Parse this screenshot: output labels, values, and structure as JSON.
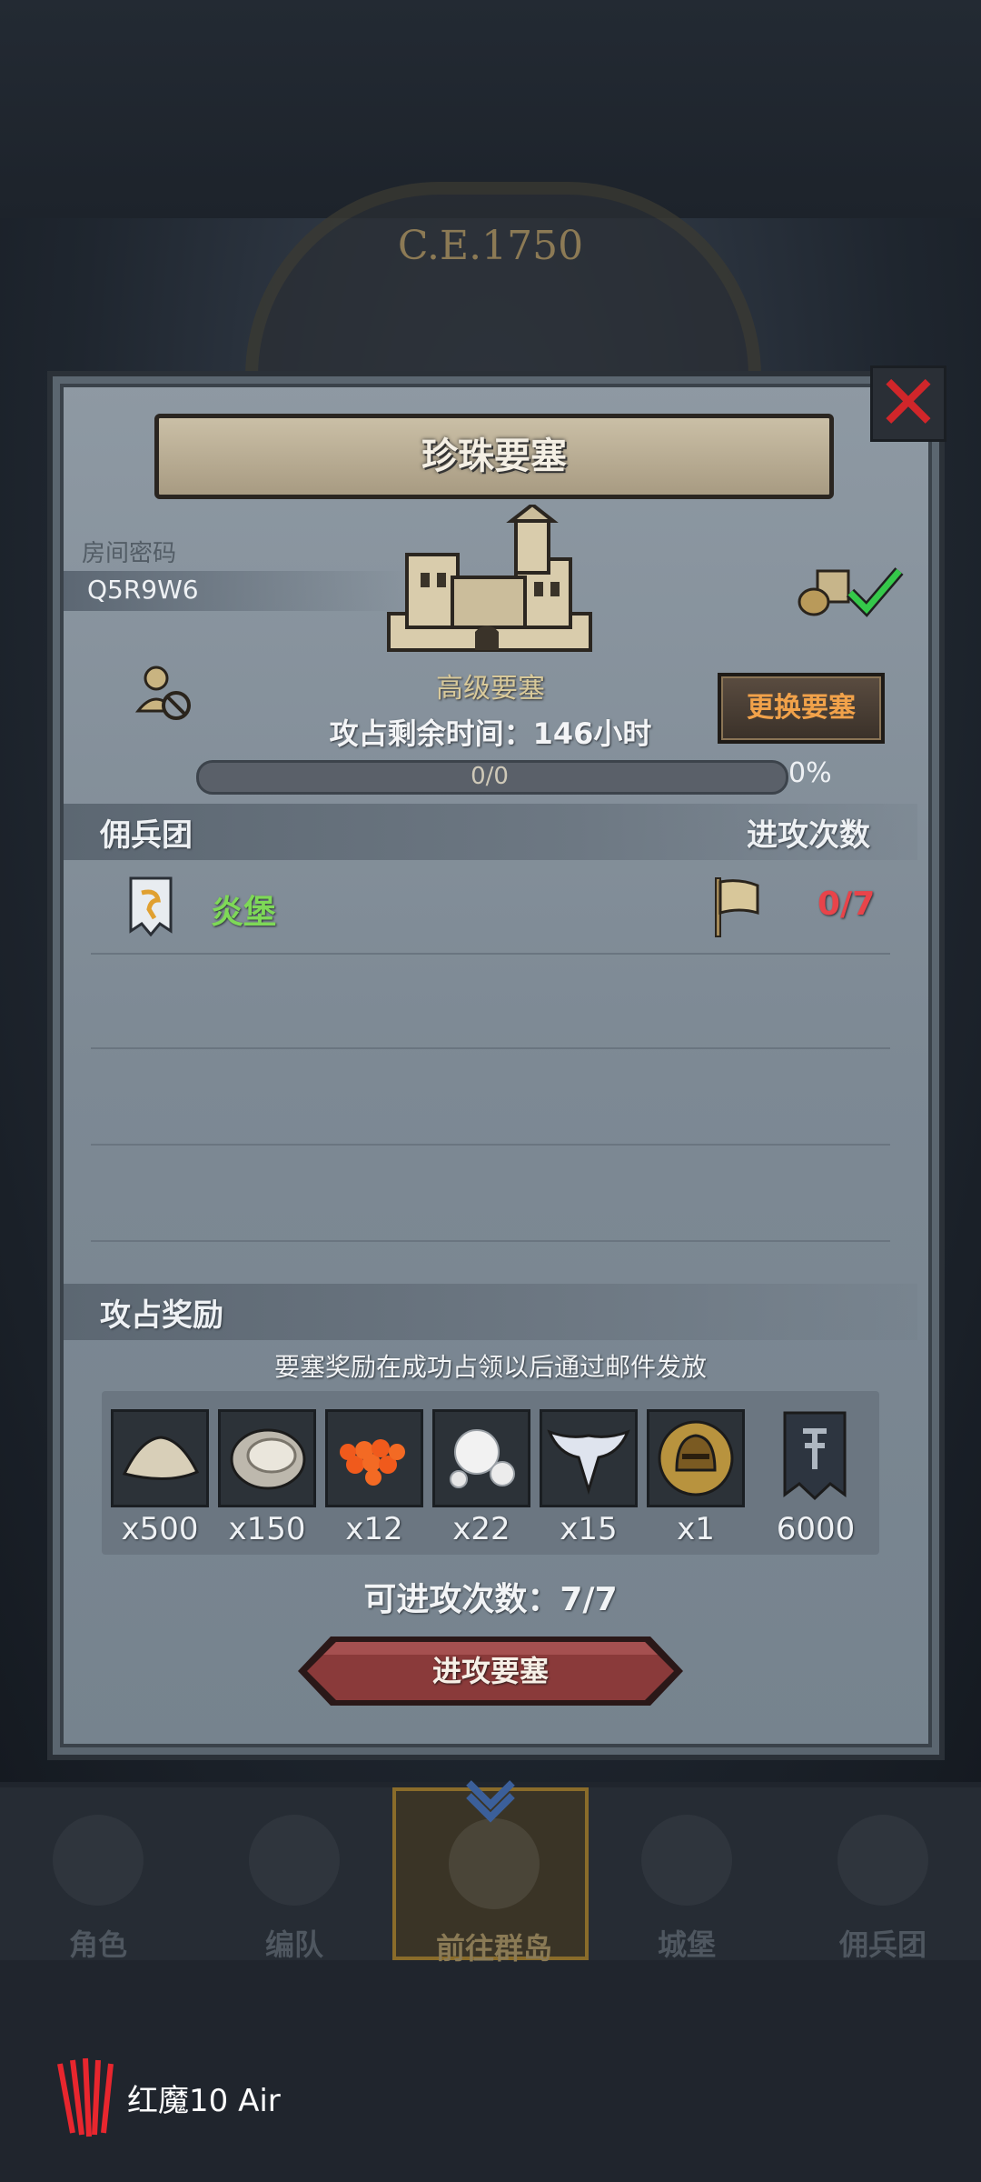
{
  "background": {
    "era_label": "C.E.1750"
  },
  "dialog": {
    "title": "珍珠要塞",
    "room_label": "房间密码",
    "room_code": "Q5R9W6",
    "fortress_level": "高级要塞",
    "change_button": "更换要塞",
    "time_remaining": "攻占剩余时间：146小时",
    "progress": {
      "text": "0/0",
      "percent_label": "0%",
      "fraction": 0
    },
    "mercenary_section": {
      "title": "佣兵团",
      "attack_count_header": "进攻次数"
    },
    "mercenaries": [
      {
        "name": "炎堡",
        "attacks": "0/7"
      }
    ],
    "reward_section": {
      "title": "攻占奖励",
      "note": "要塞奖励在成功占领以后通过邮件发放",
      "items": [
        {
          "icon": "sand-pile-icon",
          "qty": "x500"
        },
        {
          "icon": "oyster-icon",
          "qty": "x150"
        },
        {
          "icon": "fish-roe-icon",
          "qty": "x12"
        },
        {
          "icon": "pearl-icon",
          "qty": "x22"
        },
        {
          "icon": "winged-emblem-icon",
          "qty": "x15"
        },
        {
          "icon": "knight-helmet-coin-icon",
          "qty": "x1"
        },
        {
          "icon": "banner-icon",
          "qty": "6000"
        }
      ]
    },
    "attempts_text": "可进攻次数：7/7",
    "attack_button": "进攻要塞"
  },
  "nav": {
    "items": [
      {
        "label": "角色",
        "icon": "knight-icon"
      },
      {
        "label": "编队",
        "icon": "armor-icon"
      },
      {
        "label": "前往群岛",
        "icon": "compass-icon",
        "active": true
      },
      {
        "label": "城堡",
        "icon": "castle-icon"
      },
      {
        "label": "佣兵团",
        "icon": "banner-icon"
      }
    ]
  },
  "device_brand": "红魔10 Air",
  "colors": {
    "title_text": "#f4efe4",
    "mercenary_name": "#7ed957",
    "attack_count": "#e8444a",
    "change_button_text": "#f1a24a",
    "close_x": "#d0262a"
  }
}
